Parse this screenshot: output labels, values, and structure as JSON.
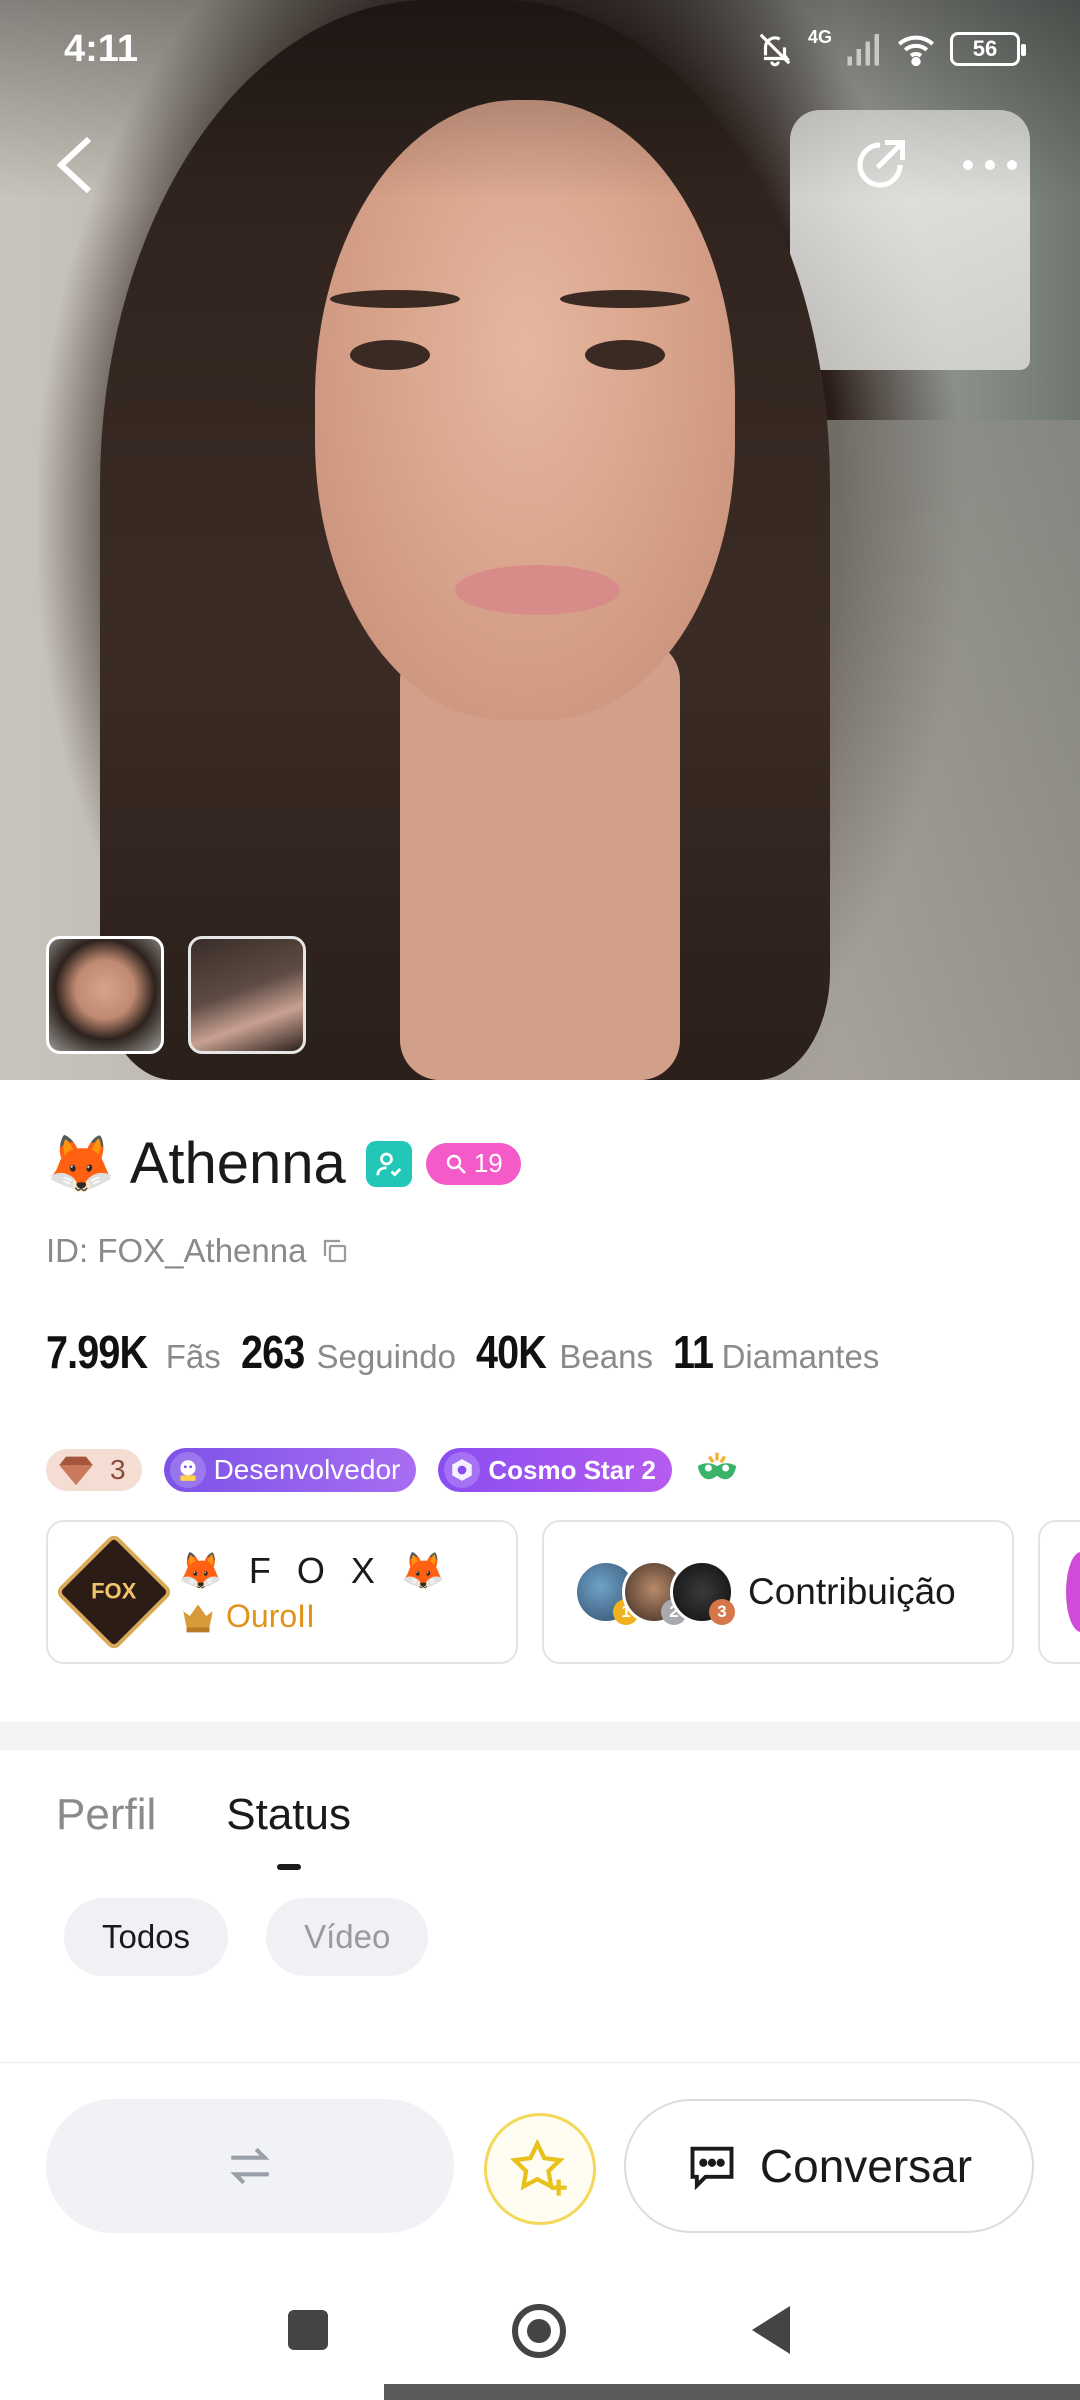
{
  "status_bar": {
    "time": "4:11",
    "network": "4G",
    "battery": "56",
    "icons": [
      "bell-muted-icon",
      "signal-icon",
      "wifi-icon",
      "battery-icon"
    ]
  },
  "header": {
    "back_icon": "chevron-left-icon",
    "share_icon": "share-icon",
    "more_icon": "more-dots-icon"
  },
  "profile": {
    "name_emoji": "🦊",
    "name": "Athenna",
    "level": "19",
    "id_label": "ID: FOX_Athenna",
    "stats": [
      {
        "value": "7.99K",
        "label": "Fãs"
      },
      {
        "value": "263",
        "label": "Seguindo"
      },
      {
        "value": "40K",
        "label": "Beans"
      },
      {
        "value": "11",
        "label": "Diamantes"
      }
    ],
    "badges": {
      "gem_count": "3",
      "developer": "Desenvolvedor",
      "cosmo": "Cosmo Star 2"
    }
  },
  "family_card": {
    "logo_text": "FOX",
    "name": "🦊 F O X 🦊",
    "rank": "OuroII"
  },
  "contribution_card": {
    "label": "Contribuição",
    "ranks": [
      "1",
      "2",
      "3"
    ]
  },
  "tabs": [
    {
      "label": "Perfil",
      "active": false
    },
    {
      "label": "Status",
      "active": true
    }
  ],
  "filters": [
    {
      "label": "Todos",
      "active": true
    },
    {
      "label": "Vídeo",
      "active": false
    }
  ],
  "bottom_actions": {
    "chat_label": "Conversar"
  },
  "colors": {
    "verified": "#22c7b8",
    "level": "#f45ac8",
    "rank_gold": "#e0921a",
    "star_border": "#f3d75a"
  }
}
